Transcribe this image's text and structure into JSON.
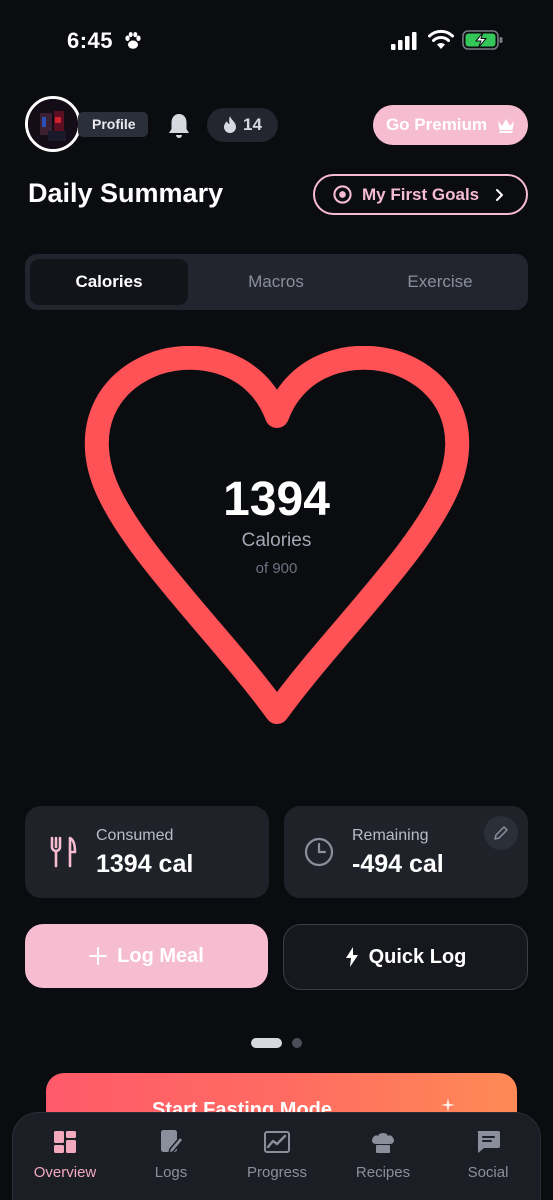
{
  "status_bar": {
    "time": "6:45",
    "icons": [
      "paw-icon",
      "signal-icon",
      "wifi-icon",
      "battery-charging-icon"
    ]
  },
  "header": {
    "profile_label": "Profile",
    "streak_count": "14",
    "premium_label": "Go Premium"
  },
  "summary": {
    "title": "Daily Summary",
    "goals_label": "My First Goals"
  },
  "tabs": [
    {
      "label": "Calories",
      "active": true
    },
    {
      "label": "Macros",
      "active": false
    },
    {
      "label": "Exercise",
      "active": false
    }
  ],
  "calorie_ring": {
    "value": "1394",
    "label": "Calories",
    "goal": "of 900"
  },
  "stats": {
    "consumed": {
      "label": "Consumed",
      "value": "1394 cal"
    },
    "remaining": {
      "label": "Remaining",
      "value": "-494 cal"
    }
  },
  "actions": {
    "log_meal": "Log Meal",
    "quick_log": "Quick Log"
  },
  "pager": {
    "pages": 2,
    "current": 1
  },
  "promo": {
    "title": "Start Fasting Mode"
  },
  "bottom_nav": [
    {
      "label": "Overview",
      "icon": "overview-icon",
      "active": true
    },
    {
      "label": "Logs",
      "icon": "logs-icon",
      "active": false
    },
    {
      "label": "Progress",
      "icon": "progress-icon",
      "active": false
    },
    {
      "label": "Recipes",
      "icon": "recipes-icon",
      "active": false
    },
    {
      "label": "Social",
      "icon": "social-icon",
      "active": false
    }
  ],
  "colors": {
    "background": "#0b0c10",
    "accent_pink": "#f6bcd0",
    "heart_red": "#ff5257",
    "card": "#1f2229"
  }
}
